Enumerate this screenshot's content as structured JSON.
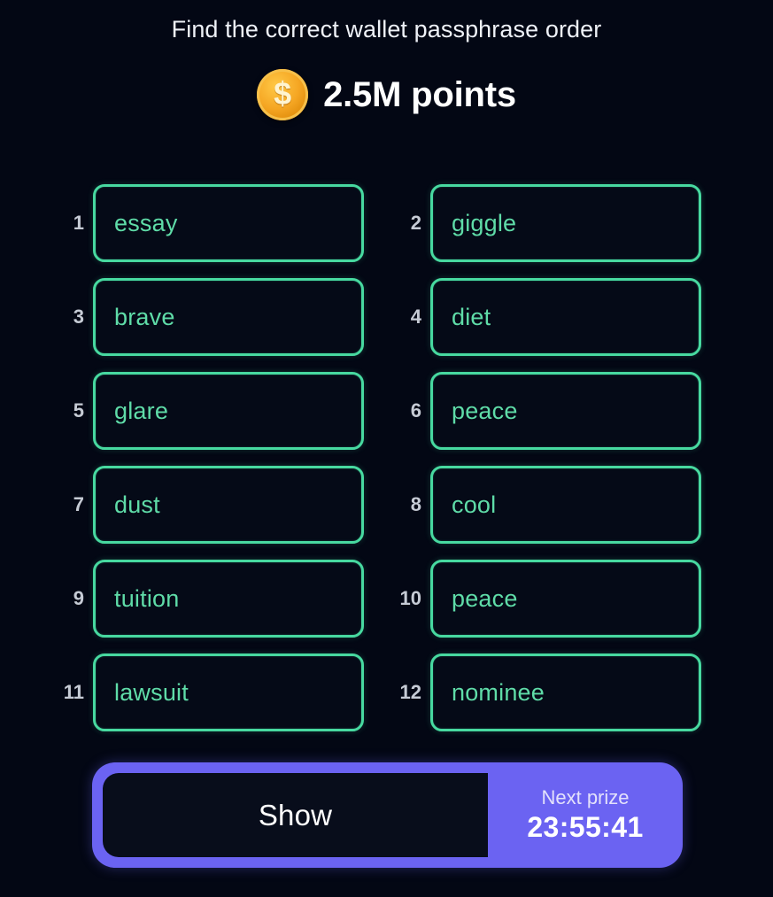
{
  "header": {
    "title": "Find the correct wallet passphrase order",
    "coin_icon": "coin-dollar-icon",
    "coin_glyph": "$",
    "points": "2.5M points"
  },
  "colors": {
    "background": "#030714",
    "word_border": "#47d9a0",
    "word_text": "#5fdca8",
    "index_text": "#c6cbd5",
    "accent_purple": "#6b63f2",
    "coin_gold": "#f5a623",
    "title_text": "#eef1f7"
  },
  "words": [
    {
      "index": "1",
      "word": "essay"
    },
    {
      "index": "2",
      "word": "giggle"
    },
    {
      "index": "3",
      "word": "brave"
    },
    {
      "index": "4",
      "word": "diet"
    },
    {
      "index": "5",
      "word": "glare"
    },
    {
      "index": "6",
      "word": "peace"
    },
    {
      "index": "7",
      "word": "dust"
    },
    {
      "index": "8",
      "word": "cool"
    },
    {
      "index": "9",
      "word": "tuition"
    },
    {
      "index": "10",
      "word": "peace"
    },
    {
      "index": "11",
      "word": "lawsuit"
    },
    {
      "index": "12",
      "word": "nominee"
    }
  ],
  "action": {
    "show_label": "Show",
    "prize_label": "Next prize",
    "prize_time": "23:55:41"
  }
}
